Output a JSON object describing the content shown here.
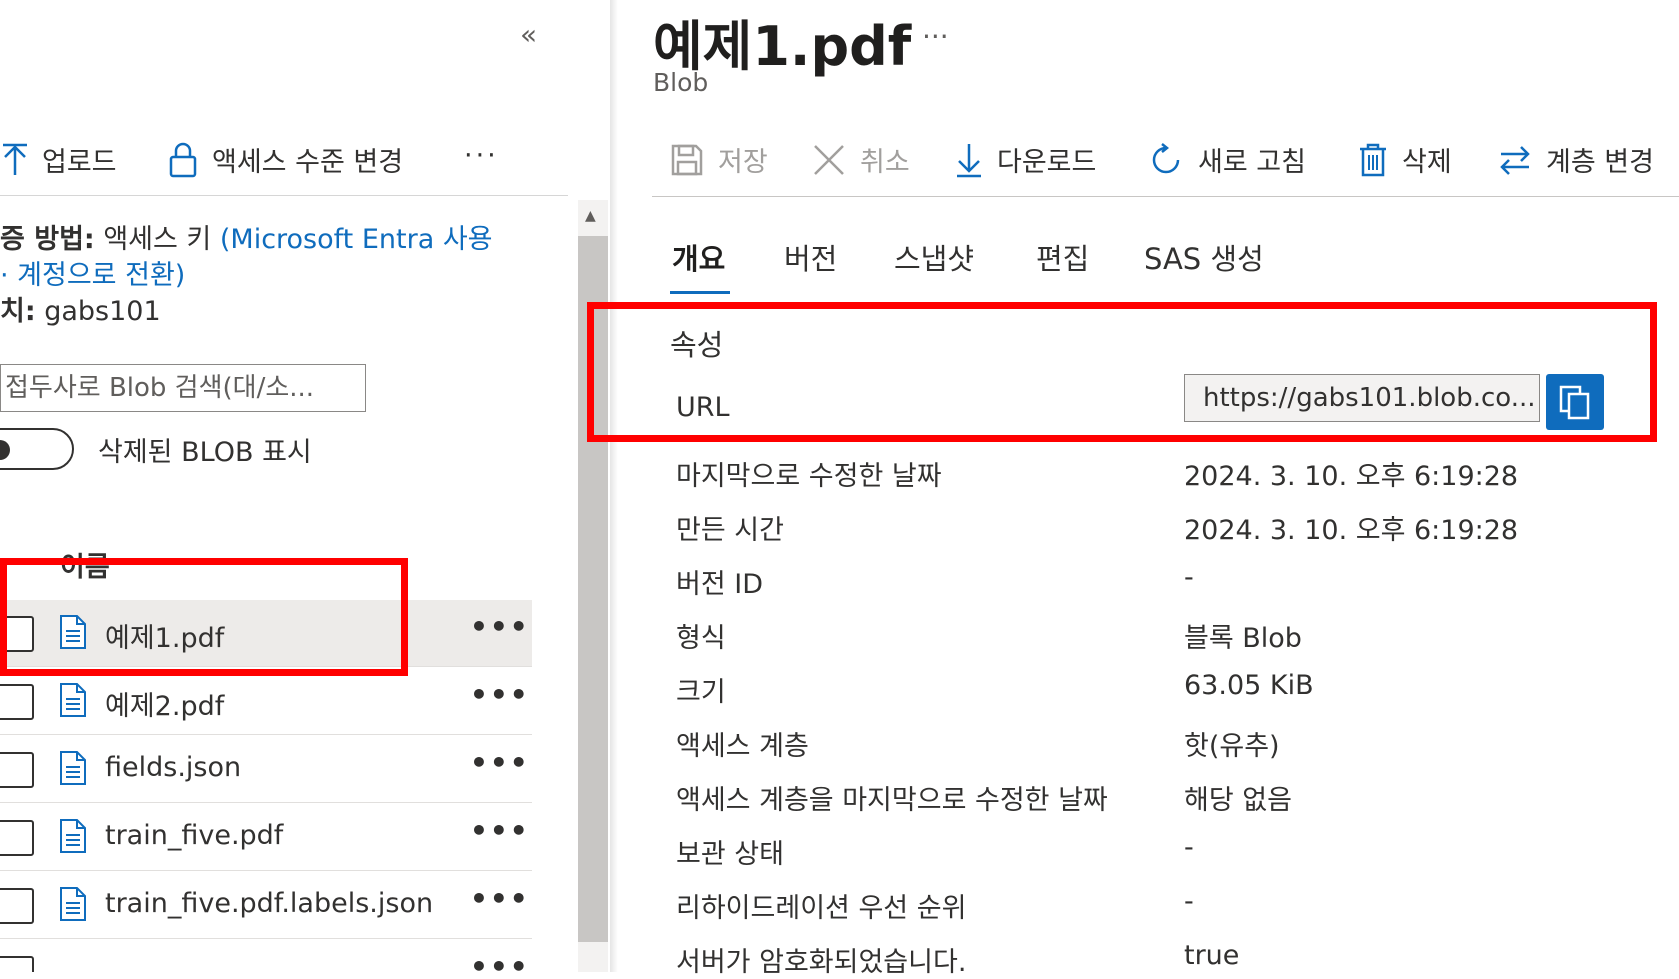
{
  "left": {
    "collapse_glyph": "«",
    "toolbar": {
      "upload_label": "업로드",
      "access_level_label": "액세스 수준 변경",
      "more_label": "···"
    },
    "auth": {
      "method_label": "증 방법:",
      "method_value": "액세스 키",
      "switch_link_line1": "(Microsoft Entra 사용",
      "switch_link_line2": "· 계정으로 전환)",
      "location_label": "치:",
      "location_value": "gabs101"
    },
    "search": {
      "placeholder": "접두사로 Blob 검색(대/소..."
    },
    "show_deleted_label": "삭제된 BLOB 표시",
    "column_name": "이름",
    "files": [
      {
        "name": "예제1.pdf",
        "selected": true
      },
      {
        "name": "예제2.pdf",
        "selected": false
      },
      {
        "name": "fields.json",
        "selected": false
      },
      {
        "name": "train_five.pdf",
        "selected": false
      },
      {
        "name": "train_five.pdf.labels.json",
        "selected": false
      }
    ],
    "row_more": "•••"
  },
  "detail": {
    "title": "예제1.pdf",
    "title_more": "···",
    "subtitle": "Blob",
    "toolbar": {
      "save": "저장",
      "cancel": "취소",
      "download": "다운로드",
      "refresh": "새로 고침",
      "delete": "삭제",
      "change_tier": "계층 변경"
    },
    "tabs": [
      "개요",
      "버전",
      "스냅샷",
      "편집",
      "SAS 생성"
    ],
    "active_tab": "개요",
    "section_title": "속성",
    "url": {
      "label": "URL",
      "value": "https://gabs101.blob.co..."
    },
    "properties": [
      {
        "label": "마지막으로 수정한 날짜",
        "value": "2024. 3. 10. 오후 6:19:28"
      },
      {
        "label": "만든 시간",
        "value": "2024. 3. 10. 오후 6:19:28"
      },
      {
        "label": "버전 ID",
        "value": "-"
      },
      {
        "label": "형식",
        "value": "블록 Blob"
      },
      {
        "label": "크기",
        "value": "63.05 KiB"
      },
      {
        "label": "액세스 계층",
        "value": "핫(유추)"
      },
      {
        "label": "액세스 계층을 마지막으로 수정한 날짜",
        "value": "해당 없음"
      },
      {
        "label": "보관 상태",
        "value": "-"
      },
      {
        "label": "리하이드레이션 우선 순위",
        "value": "-"
      },
      {
        "label": "서버가 암호화되었습니다.",
        "value": "true"
      }
    ]
  },
  "colors": {
    "accent": "#0f6cbd",
    "highlight": "#ff0000",
    "selected_row": "#edebe9"
  }
}
